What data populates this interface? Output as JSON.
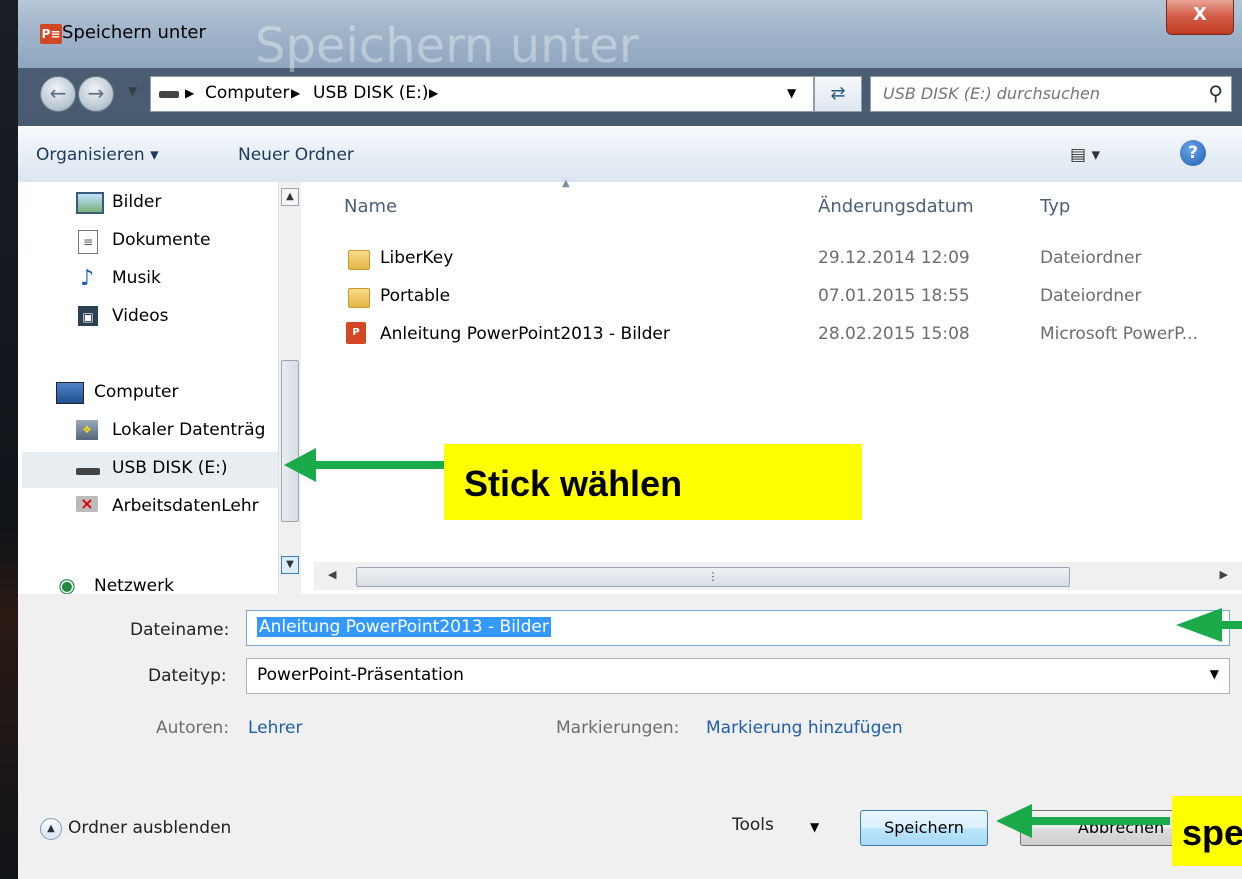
{
  "window": {
    "title": "Speichern unter",
    "ghost_title": "Speichern unter",
    "app_icon": "P≡",
    "close_symbol": "X"
  },
  "navigation": {
    "breadcrumb": [
      "Computer",
      "USB DISK (E:)"
    ],
    "search_placeholder": "USB DISK (E:) durchsuchen"
  },
  "toolbar": {
    "organize_label": "Organisieren ▾",
    "new_folder_label": "Neuer Ordner",
    "view_symbol": "▤ ▾"
  },
  "sidebar": {
    "items": [
      {
        "label": "Bilder",
        "icon": "picture-icon"
      },
      {
        "label": "Dokumente",
        "icon": "document-icon"
      },
      {
        "label": "Musik",
        "icon": "music-icon"
      },
      {
        "label": "Videos",
        "icon": "video-icon"
      },
      {
        "label": "Computer",
        "icon": "computer-icon"
      },
      {
        "label": "Lokaler Datenträg",
        "icon": "local-disk-icon"
      },
      {
        "label": "USB DISK (E:)",
        "icon": "usb-drive-icon"
      },
      {
        "label": "ArbeitsdatenLehr",
        "icon": "network-drive-icon"
      },
      {
        "label": "Netzwerk",
        "icon": "network-icon"
      }
    ],
    "selected": "USB DISK (E:)"
  },
  "file_list": {
    "columns": [
      "Name",
      "Änderungsdatum",
      "Typ"
    ],
    "rows": [
      {
        "name": "LiberKey",
        "date": "29.12.2014 12:09",
        "type": "Dateiordner",
        "icon": "folder-icon"
      },
      {
        "name": "Portable",
        "date": "07.01.2015 18:55",
        "type": "Dateiordner",
        "icon": "folder-icon"
      },
      {
        "name": "Anleitung PowerPoint2013 - Bilder",
        "date": "28.02.2015 15:08",
        "type": "Microsoft PowerP...",
        "icon": "powerpoint-file-icon"
      }
    ]
  },
  "details": {
    "filename_label": "Dateiname:",
    "filename_value": "Anleitung PowerPoint2013 - Bilder",
    "filetype_label": "Dateityp:",
    "filetype_value": "PowerPoint-Präsentation",
    "authors_label": "Autoren:",
    "authors_value": "Lehrer",
    "tags_label": "Markierungen:",
    "tags_value": "Markierung hinzufügen"
  },
  "footer": {
    "hide_folders_label": "Ordner ausblenden",
    "tools_label": "Tools",
    "save_label": "Speichern",
    "cancel_label": "Abbrechen"
  },
  "annotations": {
    "stick_callout": "Stick wählen",
    "save_callout": "speichern",
    "highlight_color": "#ffff00",
    "arrow_color": "#1aaa4a"
  }
}
